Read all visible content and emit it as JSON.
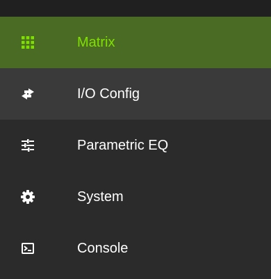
{
  "menu": {
    "items": [
      {
        "label": "Matrix",
        "icon": "grid-icon",
        "active": true
      },
      {
        "label": "I/O Config",
        "icon": "swap-arrows-icon",
        "active": false
      },
      {
        "label": "Parametric EQ",
        "icon": "sliders-icon",
        "active": false
      },
      {
        "label": "System",
        "icon": "gear-icon",
        "active": false
      },
      {
        "label": "Console",
        "icon": "terminal-icon",
        "active": false
      }
    ]
  },
  "colors": {
    "background": "#2b2b2b",
    "active_background": "#4a6b24",
    "active_text": "#7fe000",
    "hover_background": "#3a3a3a",
    "text": "#ffffff"
  }
}
